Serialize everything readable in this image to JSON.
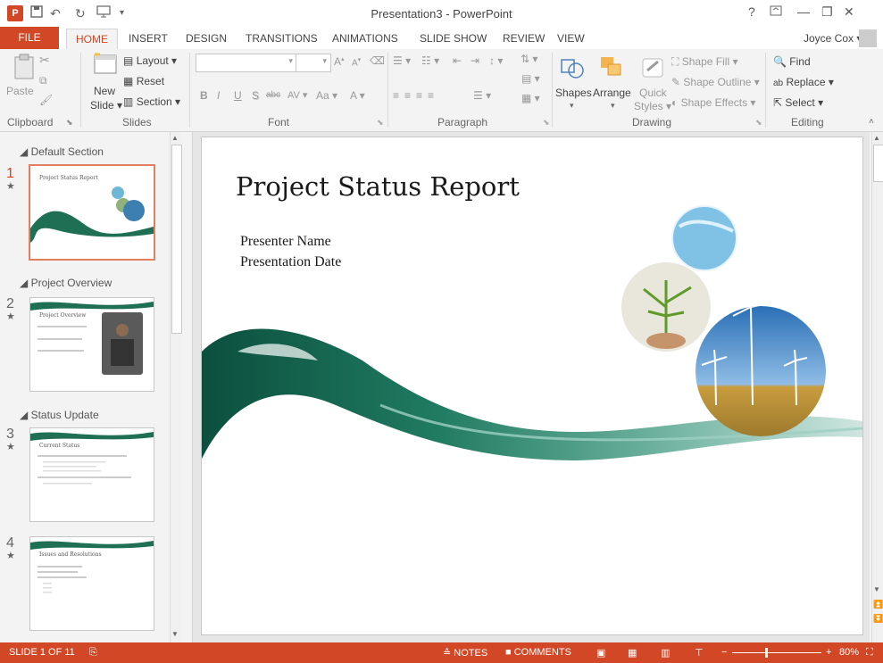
{
  "window": {
    "title": "Presentation3 - PowerPoint",
    "help": "?",
    "user": "Joyce Cox"
  },
  "qat": {
    "app_icon": "P",
    "save": "💾",
    "undo": "↶",
    "redo": "↻",
    "present": "▶"
  },
  "tabs": [
    "FILE",
    "HOME",
    "INSERT",
    "DESIGN",
    "TRANSITIONS",
    "ANIMATIONS",
    "SLIDE SHOW",
    "REVIEW",
    "VIEW"
  ],
  "ribbon": {
    "clipboard": {
      "paste": "Paste",
      "label": "Clipboard"
    },
    "slides": {
      "new_slide": "New",
      "new_slide2": "Slide",
      "layout": "Layout",
      "reset": "Reset",
      "section": "Section",
      "label": "Slides"
    },
    "font": {
      "label": "Font",
      "bold": "B",
      "italic": "I",
      "underline": "U",
      "strike": "S",
      "abc": "abc",
      "av": "AV",
      "aa": "Aa",
      "a": "A"
    },
    "paragraph": {
      "label": "Paragraph"
    },
    "drawing": {
      "shapes": "Shapes",
      "arrange": "Arrange",
      "quick": "Quick",
      "styles": "Styles",
      "fill": "Shape Fill",
      "outline": "Shape Outline",
      "effects": "Shape Effects",
      "label": "Drawing"
    },
    "editing": {
      "find": "Find",
      "replace": "Replace",
      "select": "Select",
      "label": "Editing"
    }
  },
  "sections": [
    {
      "name": "Default Section",
      "slides": [
        {
          "num": "1",
          "title": "Project Status Report"
        }
      ]
    },
    {
      "name": "Project Overview",
      "slides": [
        {
          "num": "2",
          "title": "Project Overview"
        }
      ]
    },
    {
      "name": "Status Update",
      "slides": [
        {
          "num": "3",
          "title": "Current Status"
        },
        {
          "num": "4",
          "title": "Issues and Resolutions"
        }
      ]
    }
  ],
  "slide": {
    "title": "Project Status Report",
    "line1": "Presenter Name",
    "line2": "Presentation Date"
  },
  "status": {
    "slide_of": "SLIDE 1 OF 11",
    "notes": "NOTES",
    "comments": "COMMENTS",
    "zoom": "80%"
  },
  "colors": {
    "accent": "#d24726"
  }
}
